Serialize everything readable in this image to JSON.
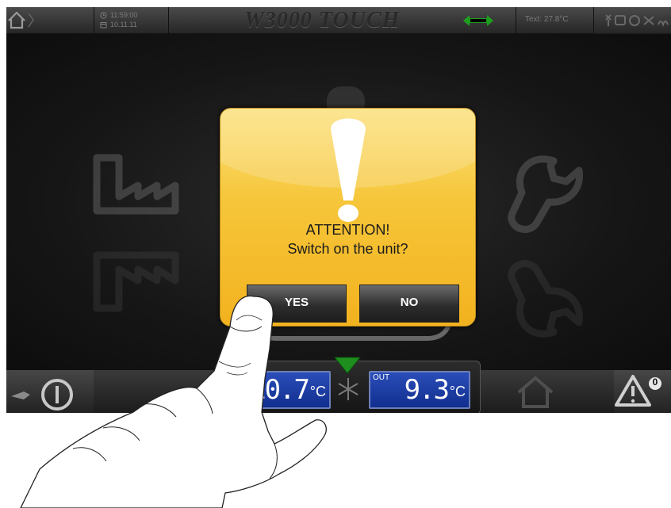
{
  "app": {
    "title": "W3000 TOUCH"
  },
  "topbar": {
    "time": "11:59:00",
    "date": "10.11.11",
    "text_temp": "Text: 27.8°C",
    "icons": [
      "home-icon",
      "clock-icon",
      "calendar-icon",
      "link-arrows-icon",
      "status-icons"
    ]
  },
  "dialog": {
    "title": "ATTENTION!",
    "message": "Switch on the unit?",
    "yes_label": "YES",
    "no_label": "NO",
    "icon": "exclamation-icon"
  },
  "bottombar": {
    "in_temp": "10.7",
    "in_unit": "°C",
    "out_label": "OUT",
    "out_temp": "9.3",
    "out_unit": "°C",
    "alarm_count": "0",
    "icons": [
      "power-icon",
      "snowflake-icon",
      "home-icon",
      "alarm-warning-icon"
    ]
  },
  "colors": {
    "dialog": "#f6c63a",
    "lcd": "#1f43ad",
    "link_arrow": "#1e9e1e",
    "indicator": "#1e8f1e"
  }
}
